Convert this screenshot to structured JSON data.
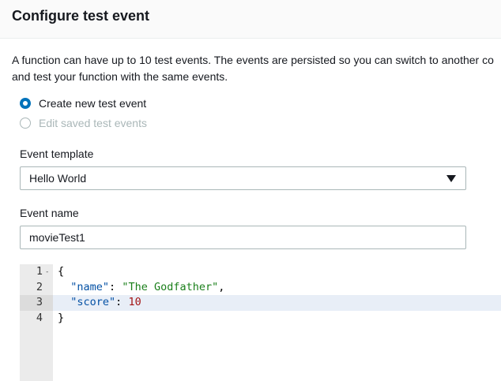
{
  "dialog": {
    "title": "Configure test event",
    "description_line1": "A function can have up to 10 test events. The events are persisted so you can switch to another co",
    "description_line2": "and test your function with the same events."
  },
  "options": {
    "create_new": {
      "label": "Create new test event",
      "selected": true
    },
    "edit_saved": {
      "label": "Edit saved test events",
      "disabled": true
    }
  },
  "template": {
    "label": "Event template",
    "selected": "Hello World"
  },
  "event_name": {
    "label": "Event name",
    "value": "movieTest1"
  },
  "editor": {
    "line_numbers": [
      "1",
      "2",
      "3",
      "4"
    ],
    "fold_marker": "-",
    "line1": "{",
    "line2_key": "\"name\"",
    "line2_colon": ": ",
    "line2_value": "\"The Godfather\"",
    "line2_comma": ",",
    "line3_key": "\"score\"",
    "line3_colon": ": ",
    "line3_value": "10",
    "line4": "}"
  }
}
